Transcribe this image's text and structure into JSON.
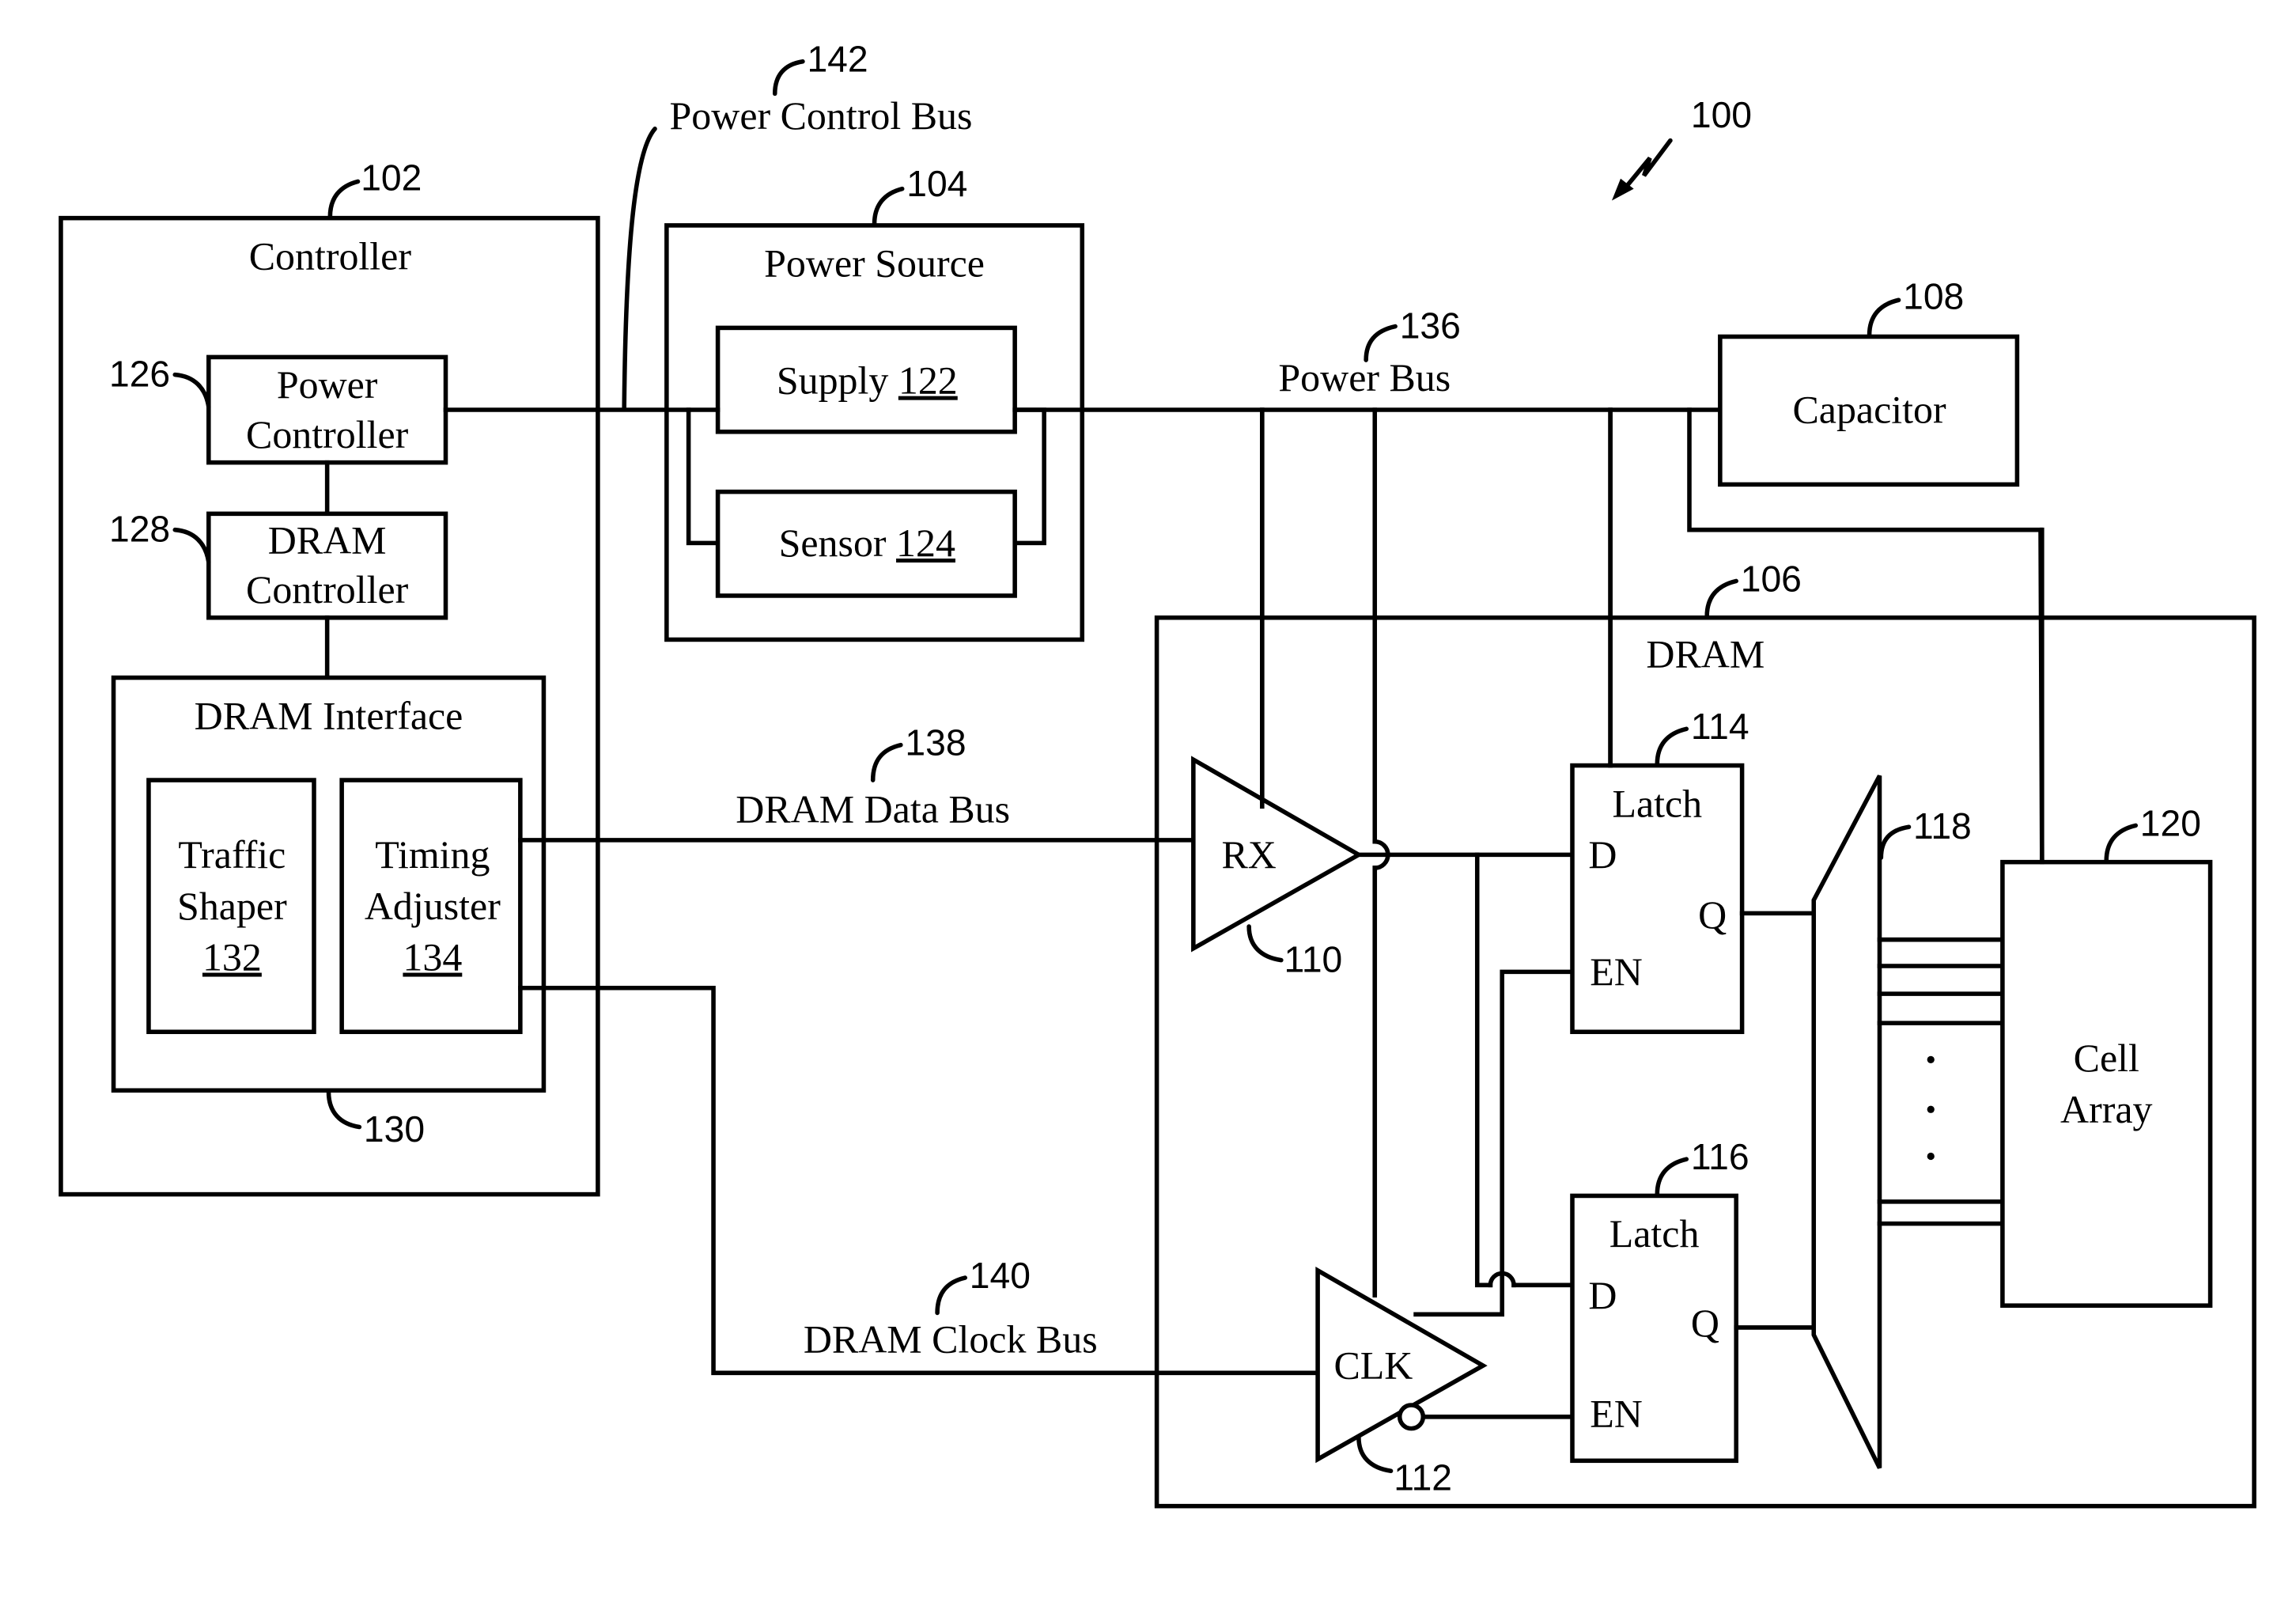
{
  "figure": {
    "ref": "100",
    "controller": {
      "ref": "102",
      "title": "Controller",
      "power_controller": {
        "ref": "126",
        "line1": "Power",
        "line2": "Controller"
      },
      "dram_controller": {
        "ref": "128",
        "line1": "DRAM",
        "line2": "Controller"
      },
      "dram_interface": {
        "ref": "130",
        "title": "DRAM Interface",
        "traffic_shaper": {
          "line1": "Traffic",
          "line2": "Shaper",
          "ref": "132"
        },
        "timing_adjuster": {
          "line1": "Timing",
          "line2": "Adjuster",
          "ref": "134"
        }
      }
    },
    "power_source": {
      "ref": "104",
      "title": "Power Source",
      "supply": {
        "label": "Supply",
        "ref": "122"
      },
      "sensor": {
        "label": "Sensor",
        "ref": "124"
      }
    },
    "capacitor": {
      "ref": "108",
      "label": "Capacitor"
    },
    "dram": {
      "ref": "106",
      "title": "DRAM",
      "rx": {
        "ref": "110",
        "label": "RX"
      },
      "clk": {
        "ref": "112",
        "label": "CLK"
      },
      "latch_a": {
        "ref": "114",
        "title": "Latch",
        "d": "D",
        "q": "Q",
        "en": "EN"
      },
      "latch_b": {
        "ref": "116",
        "title": "Latch",
        "d": "D",
        "q": "Q",
        "en": "EN"
      },
      "mux": {
        "ref": "118"
      },
      "cell_array": {
        "ref": "120",
        "line1": "Cell",
        "line2": "Array"
      },
      "ellipsis": ".",
      "ellipsis_count": 3
    },
    "buses": {
      "power_control_bus": {
        "ref": "142",
        "label": "Power Control Bus"
      },
      "power_bus": {
        "ref": "136",
        "label": "Power Bus"
      },
      "dram_data_bus": {
        "ref": "138",
        "label": "DRAM Data Bus"
      },
      "dram_clock_bus": {
        "ref": "140",
        "label": "DRAM Clock Bus"
      }
    }
  }
}
